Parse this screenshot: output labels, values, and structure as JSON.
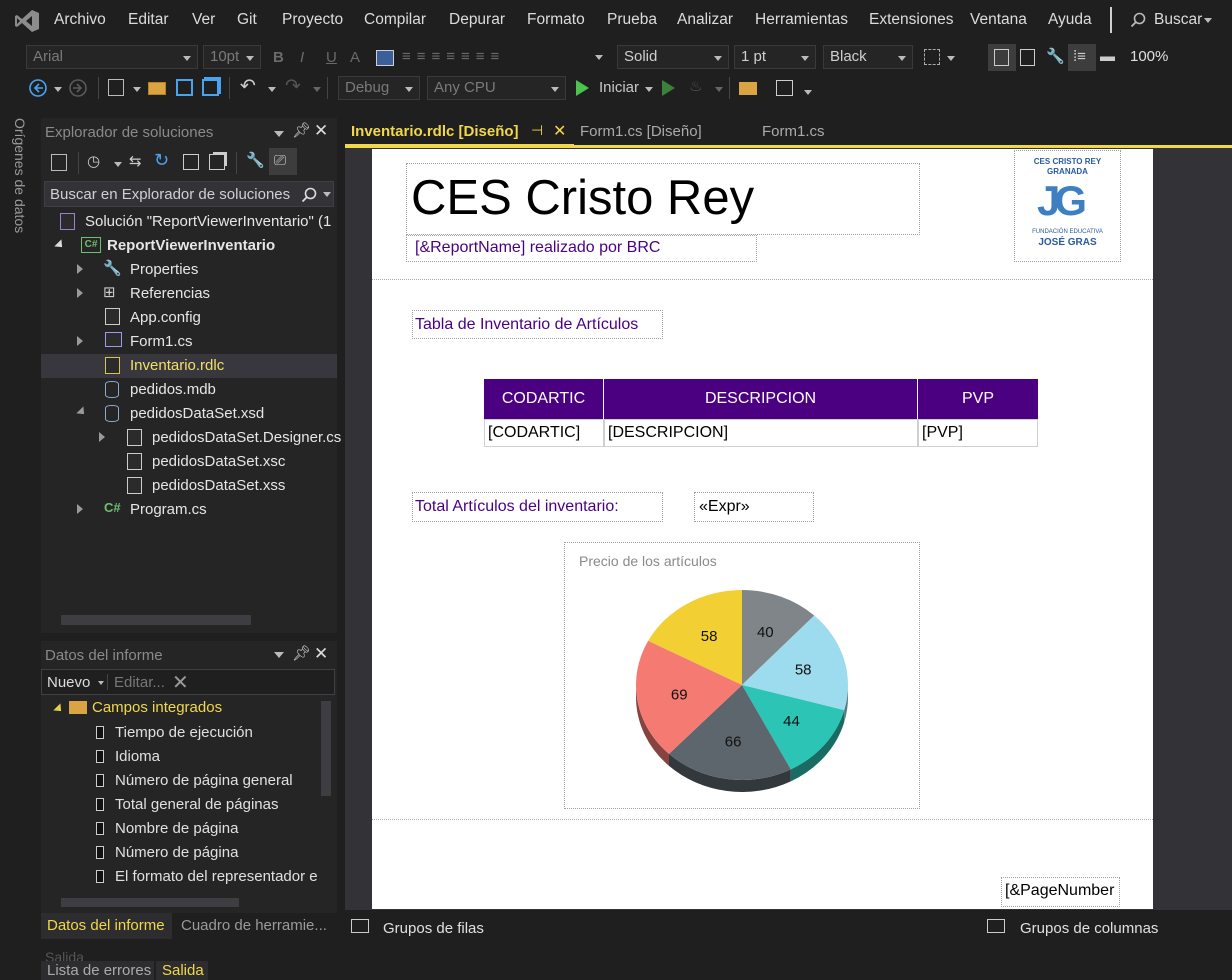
{
  "menu": [
    "Archivo",
    "Editar",
    "Ver",
    "Git",
    "Proyecto",
    "Compilar",
    "Depurar",
    "Formato",
    "Prueba",
    "Analizar",
    "Herramientas",
    "Extensiones",
    "Ventana",
    "Ayuda"
  ],
  "search_label": "Buscar",
  "format_toolbar": {
    "font": "Arial",
    "size": "10pt",
    "line_style": "Solid",
    "line_width": "1 pt",
    "color": "Black",
    "zoom": "100%"
  },
  "std_toolbar": {
    "config": "Debug",
    "platform": "Any CPU",
    "start": "Iniciar"
  },
  "side_tab": "Orígenes de datos",
  "solution_explorer": {
    "title": "Explorador de soluciones",
    "search_placeholder": "Buscar en Explorador de soluciones (",
    "solution": "Solución \"ReportViewerInventario\"  (1",
    "project": "ReportViewerInventario",
    "items": [
      "Properties",
      "Referencias",
      "App.config",
      "Form1.cs",
      "Inventario.rdlc",
      "pedidos.mdb",
      "pedidosDataSet.xsd",
      "pedidosDataSet.Designer.cs",
      "pedidosDataSet.xsc",
      "pedidosDataSet.xss",
      "Program.cs"
    ]
  },
  "report_data": {
    "title": "Datos del informe",
    "new_label": "Nuevo",
    "edit_label": "Editar...",
    "group": "Campos integrados",
    "fields": [
      "Tiempo de ejecución",
      "Idioma",
      "Número de página general",
      "Total general de páginas",
      "Nombre de página",
      "Número de página",
      "El formato del representador e"
    ]
  },
  "bottom_tabs": {
    "left_active": "Datos del informe",
    "left_other": "Cuadro de herramie..."
  },
  "doc_tabs": [
    {
      "label": "Inventario.rdlc [Diseño]",
      "active": true
    },
    {
      "label": "Form1.cs [Diseño]"
    },
    {
      "label": "Form1.cs"
    }
  ],
  "report": {
    "title": "CES Cristo Rey",
    "subtitle": "[&ReportName] realizado por BRC",
    "logo": {
      "line1": "CES CRISTO REY",
      "line2": "GRANADA",
      "mark": "JG",
      "line3": "FUNDACIÓN EDUCATIVA",
      "line4": "JOSÉ GRAS"
    },
    "table_title": "Tabla de Inventario de Artículos",
    "columns": [
      "CODARTIC",
      "DESCRIPCION",
      "PVP"
    ],
    "row": [
      "[CODARTIC]",
      "[DESCRIPCION]",
      "[PVP]"
    ],
    "total_label": "Total Artículos del inventario:",
    "total_expr": "«Expr»",
    "page_number": "[&PageNumber"
  },
  "chart_data": {
    "type": "pie",
    "title": "Precio de los artículos",
    "values": [
      58,
      40,
      58,
      44,
      66,
      69
    ],
    "colors": [
      "#f2d033",
      "#7f8589",
      "#9ddcee",
      "#2cc4b4",
      "#5d666d",
      "#f47a72"
    ]
  },
  "grouping": {
    "rows": "Grupos de filas",
    "cols": "Grupos de columnas"
  },
  "output": {
    "ghost": "Salida",
    "tab1": "Lista de errores",
    "tab2": "Salida"
  }
}
